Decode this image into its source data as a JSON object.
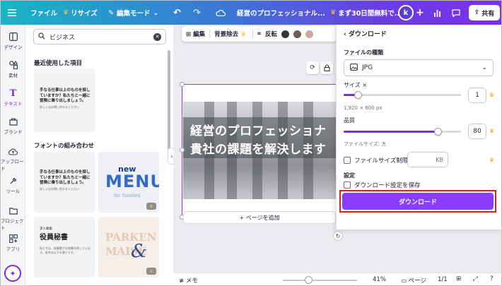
{
  "topbar": {
    "file": "ファイル",
    "resize": "リサイズ",
    "edit_mode": "編集モード",
    "doc_title": "経営のプロフェッショナル...",
    "trial": "まず30日間無料で...",
    "avatar_letter": "k",
    "share": "共有"
  },
  "rail": [
    {
      "label": "デザイン",
      "icon": "layout-icon"
    },
    {
      "label": "素材",
      "icon": "shapes-icon"
    },
    {
      "label": "テキスト",
      "icon": "text-icon"
    },
    {
      "label": "ブランド",
      "icon": "brand-icon"
    },
    {
      "label": "アップロード",
      "icon": "upload-icon"
    },
    {
      "label": "ツール",
      "icon": "tools-icon"
    },
    {
      "label": "プロジェクト",
      "icon": "folder-icon"
    },
    {
      "label": "アプリ",
      "icon": "apps-icon"
    }
  ],
  "panel": {
    "search_value": "ビジネス",
    "recent_title": "最近使用した項目",
    "combos_title": "フォントの組み合わせ",
    "card_text": "手なる仕事以上のものを探していますか？私たちと一緒に冒険に乗り出しましょう。",
    "card_small": "詳しくはお問い合わせください",
    "menu_new": "new",
    "menu_big": "MENU",
    "menu_sub": "for foodies",
    "job_small": "求人募集",
    "job_title": "役員秘書",
    "job_body": "私たちは、経験豊かな秘書を探しています。条件は以下の通りです。",
    "parken_1": "PARKEN",
    "parken_2": "MAISE"
  },
  "context_toolbar": {
    "edit": "編集",
    "bg_remove": "背景除去",
    "flip": "反転",
    "colors": [
      "#3a3336",
      "#6e5a58",
      "#c9a89e"
    ]
  },
  "canvas": {
    "headline_1": "経営のプロフェッショナ",
    "headline_2": "貴社の課題を解決します",
    "add_page": "+ ページを追加"
  },
  "download": {
    "header": "ダウンロード",
    "file_type_label": "ファイルの種類",
    "file_type": "JPG",
    "size_label": "サイズ ×",
    "size_value": "1",
    "size_fraction": 0.12,
    "dimensions": "1,920 × 600 px",
    "quality_label": "品質",
    "quality_value": "80",
    "quality_fraction": 0.8,
    "file_size": "ファイルサイズ: 大",
    "limit_label": "ファイルサイズ制限",
    "kb": "KB",
    "settings_label": "設定",
    "save_settings": "ダウンロード設定を保存",
    "button": "ダウンロード"
  },
  "bottombar": {
    "notes": "メモ",
    "zoom": "41%",
    "pages": "ページ",
    "page_count": "1/1"
  }
}
